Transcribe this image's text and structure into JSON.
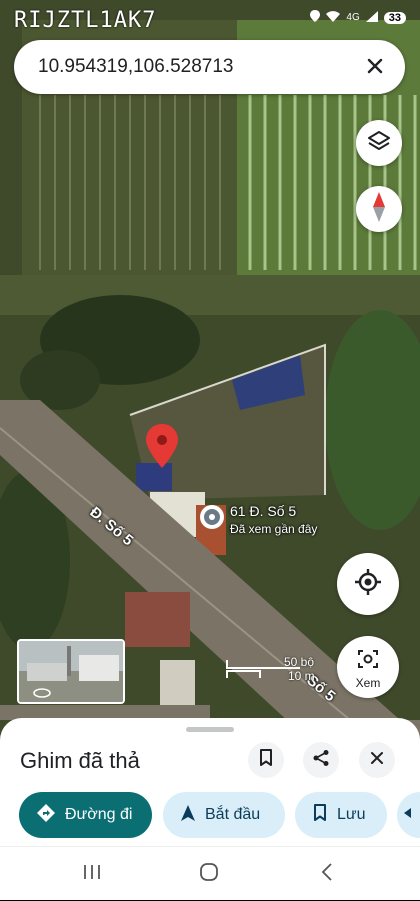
{
  "status_bar": {
    "title": "RIJZTL1AK7",
    "network": "4G",
    "battery": "33"
  },
  "search": {
    "value": "10.954319,106.528713"
  },
  "map": {
    "place_name": "61 Đ. Số 5",
    "place_subtitle": "Đã xem gần đây",
    "road_label_upper": "Đ. Số 5",
    "road_label_lower": "Số 5",
    "scale_top": "50 bộ",
    "scale_bottom": "10 m",
    "street_view_label": "Xem"
  },
  "sheet": {
    "title": "Ghim đã thả",
    "chips": [
      "Đường đi",
      "Bắt đầu",
      "Lưu"
    ]
  },
  "colors": {
    "primary_chip": "#0b6e73",
    "secondary_chip": "#d9eef8",
    "pin": "#e53935"
  }
}
